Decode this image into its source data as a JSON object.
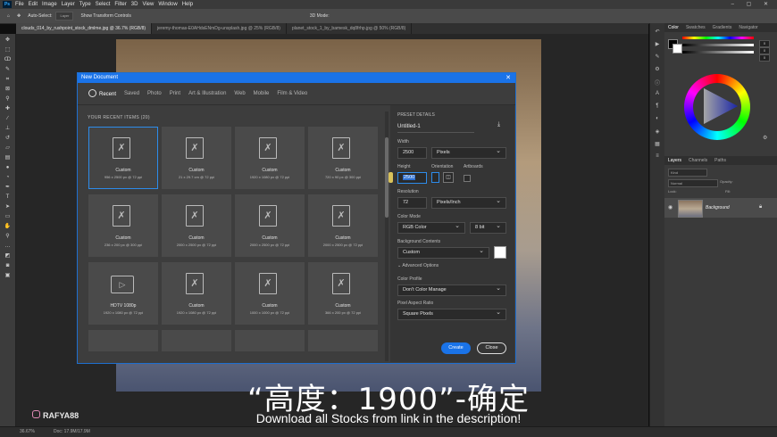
{
  "menubar": {
    "logo": "Ps",
    "items": [
      "File",
      "Edit",
      "Image",
      "Layer",
      "Type",
      "Select",
      "Filter",
      "3D",
      "View",
      "Window",
      "Help"
    ]
  },
  "options": {
    "auto_select": "Auto-Select:",
    "layer": "Layer",
    "show_transform": "Show Transform Controls",
    "mode_3d": "3D Mode:"
  },
  "doc_tabs": [
    "clouds_014_by_rushpoint_stock_dmlme.jpg @ 36.7% (RGB/8)",
    "jeremy-thomas-E0AHdsENmDg-unsplash.jpg @ 25% (RGB/8)",
    "planet_stock_1_by_bamesk_dq8frhp.jpg @ 50% (RGB/8)"
  ],
  "panels": {
    "color_tabs": [
      "Color",
      "Swatches",
      "Gradients",
      "Navigator"
    ],
    "layer_tabs": [
      "Layers",
      "Channels",
      "Paths"
    ],
    "kind": "Kind",
    "normal": "Normal",
    "opacity": "Opacity:",
    "lock": "Lock:",
    "fill": "Fill:",
    "layer_name": "Background",
    "slider_values": [
      "0",
      "0",
      "0"
    ]
  },
  "status": {
    "zoom": "36.67%",
    "doc": "Doc: 17.9M/17.9M"
  },
  "dialog": {
    "title": "New Document",
    "tabs": [
      "Recent",
      "Saved",
      "Photo",
      "Print",
      "Art & Illustration",
      "Web",
      "Mobile",
      "Film & Video"
    ],
    "recent_label": "YOUR RECENT ITEMS (20)",
    "items": [
      {
        "name": "Custom",
        "dims": "956 x 2500 px @ 72 ppi"
      },
      {
        "name": "Custom",
        "dims": "21 x 29.7 cm @ 72 ppi"
      },
      {
        "name": "Custom",
        "dims": "1920 x 1080 px @ 72 ppi"
      },
      {
        "name": "Custom",
        "dims": "720 x 90 px @ 300 ppi"
      },
      {
        "name": "Custom",
        "dims": "236 x 200 px @ 300 ppi"
      },
      {
        "name": "Custom",
        "dims": "2000 x 2500 px @ 72 ppi"
      },
      {
        "name": "Custom",
        "dims": "2000 x 2500 px @ 72 ppi"
      },
      {
        "name": "Custom",
        "dims": "2000 x 2500 px @ 72 ppi"
      },
      {
        "name": "HDTV 1080p",
        "dims": "1920 x 1080 px @ 72 ppi"
      },
      {
        "name": "Custom",
        "dims": "1920 x 1080 px @ 72 ppi"
      },
      {
        "name": "Custom",
        "dims": "1000 x 1000 px @ 72 ppi"
      },
      {
        "name": "Custom",
        "dims": "366 x 200 px @ 72 ppi"
      }
    ],
    "preset": {
      "heading": "PRESET DETAILS",
      "name": "Untitled-1",
      "width_label": "Width",
      "width_value": "2500",
      "width_unit": "Pixels",
      "height_label": "Height",
      "height_value": "2500",
      "orientation_label": "Orientation",
      "artboards_label": "Artboards",
      "resolution_label": "Resolution",
      "resolution_value": "72",
      "resolution_unit": "Pixels/Inch",
      "color_mode_label": "Color Mode",
      "color_mode": "RGB Color",
      "bit_depth": "8 bit",
      "bg_label": "Background Contents",
      "bg_value": "Custom",
      "advanced": "Advanced Options",
      "profile_label": "Color Profile",
      "profile_value": "Don't Color Manage",
      "aspect_label": "Pixel Aspect Ratio",
      "aspect_value": "Square Pixels",
      "create": "Create",
      "close": "Close"
    }
  },
  "overlay": {
    "caption": "“高度：1900”-确定",
    "subtitle": "Download all Stocks from link in the description!",
    "watermark": "RAFYA88"
  },
  "colors": {
    "accent": "#1a73e8",
    "bg_swatch": "#ffffff"
  }
}
